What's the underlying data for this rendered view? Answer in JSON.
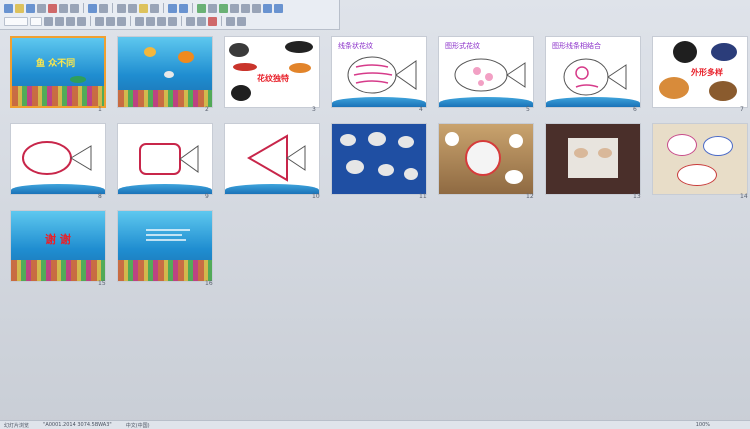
{
  "slides": [
    {
      "number": "1",
      "big_text": "鱼 众不同"
    },
    {
      "number": "2"
    },
    {
      "number": "3",
      "big_text": "花纹独特"
    },
    {
      "number": "4",
      "title": "线条状花纹"
    },
    {
      "number": "5",
      "title": "图形式花纹"
    },
    {
      "number": "6",
      "title": "图形线条相结合"
    },
    {
      "number": "7",
      "big_text": "外形多样"
    },
    {
      "number": "8"
    },
    {
      "number": "9"
    },
    {
      "number": "10"
    },
    {
      "number": "11"
    },
    {
      "number": "12"
    },
    {
      "number": "13"
    },
    {
      "number": "14"
    },
    {
      "number": "15",
      "big_text": "谢 谢"
    },
    {
      "number": "16"
    }
  ],
  "status_bar": {
    "view": "幻灯片浏览",
    "theme": "\"A0001.2014 3074.5BWA3\"",
    "language": "中文(中国)",
    "zoom": "100%"
  },
  "colors": {
    "selected_border": "#f0a030",
    "background": "#c9ced6",
    "title_purple": "#8a2fc9",
    "big_red": "#e8202a"
  }
}
